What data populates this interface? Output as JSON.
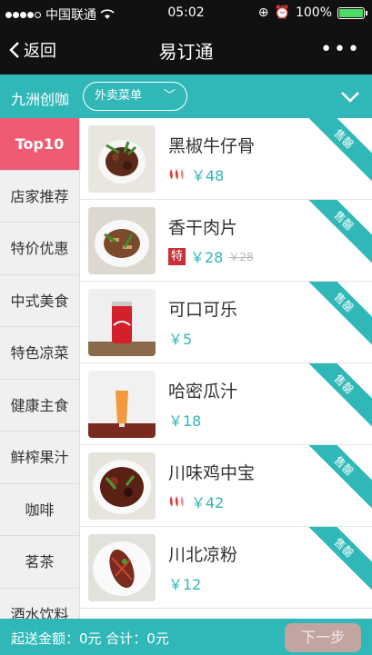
{
  "status_bar": {
    "carrier": "中国联通",
    "time": "05:02",
    "battery": "100%"
  },
  "nav": {
    "back_label": "返回",
    "title": "易订通",
    "more_label": "•••"
  },
  "filter": {
    "store_name": "九洲创咖",
    "dropdown_value": "外卖菜单"
  },
  "categories": [
    {
      "label": "Top10"
    },
    {
      "label": "店家推荐"
    },
    {
      "label": "特价优惠"
    },
    {
      "label": "中式美食"
    },
    {
      "label": "特色凉菜"
    },
    {
      "label": "健康主食"
    },
    {
      "label": "鲜榨果汁"
    },
    {
      "label": "咖啡"
    },
    {
      "label": "茗茶"
    },
    {
      "label": "酒水饮料"
    }
  ],
  "dishes": [
    {
      "name": "黑椒牛仔骨",
      "price": "￥48",
      "spicy": true,
      "ribbon": "售罄",
      "thumb": "beef"
    },
    {
      "name": "香干肉片",
      "price": "￥28",
      "old_price": "￥28",
      "special_tag": "特",
      "ribbon": "售罄",
      "thumb": "tofu"
    },
    {
      "name": "可口可乐",
      "price": "￥5",
      "ribbon": "售罄",
      "thumb": "cola"
    },
    {
      "name": "哈密瓜汁",
      "price": "￥18",
      "ribbon": "售罄",
      "thumb": "juice"
    },
    {
      "name": "川味鸡中宝",
      "price": "￥42",
      "spicy": true,
      "ribbon": "售罄",
      "thumb": "chicken"
    },
    {
      "name": "川北凉粉",
      "price": "￥12",
      "ribbon": "售罄",
      "thumb": "noodle"
    }
  ],
  "bottom": {
    "summary": "起送金额：0元 合计：0元",
    "next_label": "下一步"
  },
  "colors": {
    "accent": "#2fb8b7",
    "active_category": "#ef5b75",
    "nav_bg": "#111111"
  }
}
